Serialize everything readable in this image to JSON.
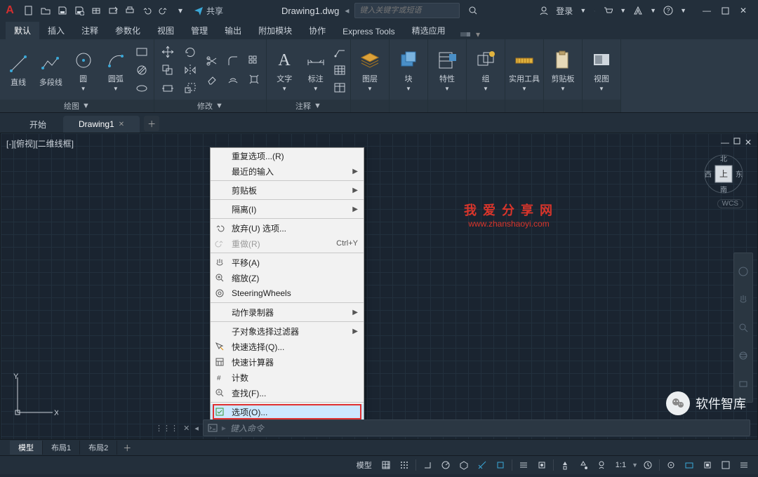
{
  "title": {
    "doc": "Drawing1.dwg",
    "share": "共享",
    "search_ph": "键入关键字或短语",
    "login": "登录"
  },
  "tabs": [
    "默认",
    "插入",
    "注释",
    "参数化",
    "视图",
    "管理",
    "输出",
    "附加模块",
    "协作",
    "Express Tools",
    "精选应用"
  ],
  "panels": {
    "draw": {
      "title": "绘图",
      "line": "直线",
      "pline": "多段线",
      "circle": "圆",
      "arc": "圆弧"
    },
    "modify": {
      "title": "修改"
    },
    "annot": {
      "title": "注释",
      "text": "文字",
      "dim": "标注",
      "tbl": "表格"
    },
    "layers": "图层",
    "blocks": "块",
    "props": "特性",
    "groups": "组",
    "utils": "实用工具",
    "clip": "剪贴板",
    "view": "视图"
  },
  "files": {
    "start": "开始",
    "drawing": "Drawing1"
  },
  "viewport": {
    "label": "[-][俯视][二维线框]",
    "wcs": "WCS",
    "cube": {
      "n": "北",
      "s": "南",
      "e": "东",
      "w": "西",
      "top": "上"
    }
  },
  "ctx": {
    "repeat": "重复选项...(R)",
    "recent": "最近的输入",
    "clip": "剪贴板",
    "isolate": "隔离(I)",
    "undo": "放弃(U) 选项...",
    "redo": "重做(R)",
    "redo_sc": "Ctrl+Y",
    "pan": "平移(A)",
    "zoom": "缩放(Z)",
    "sw": "SteeringWheels",
    "rec": "动作录制器",
    "subf": "子对象选择过滤器",
    "qsel": "快速选择(Q)...",
    "qcalc": "快速计算器",
    "count": "计数",
    "find": "查找(F)...",
    "opts": "选项(O)..."
  },
  "cmd": {
    "ph": "键入命令"
  },
  "layouts": {
    "model": "模型",
    "l1": "布局1",
    "l2": "布局2"
  },
  "status": {
    "model": "模型",
    "scale": "1:1"
  },
  "watermark": {
    "l1": "我 爱 分 享 网",
    "l2": "www.zhanshaoyi.com"
  },
  "brand": "软件智库"
}
